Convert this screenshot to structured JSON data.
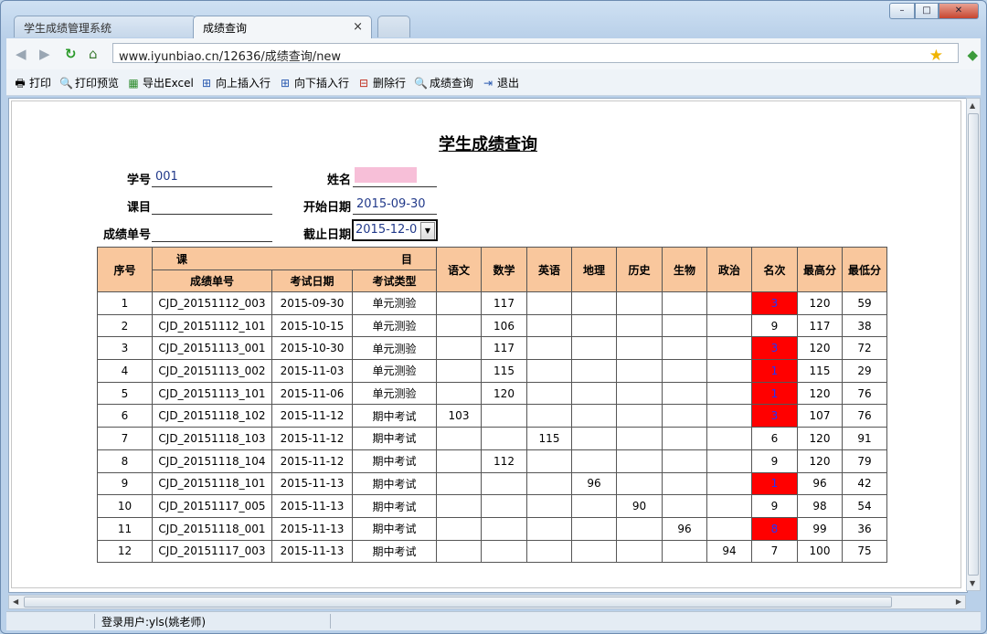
{
  "browser": {
    "tabs": [
      {
        "label": "学生成绩管理系统",
        "active": false
      },
      {
        "label": "成绩查询",
        "active": true
      }
    ],
    "tab_close": "×",
    "url": "www.iyunbiao.cn/12636/成绩查询/new",
    "window_controls": {
      "minimize": "–",
      "maximize": "□",
      "close": "✕"
    }
  },
  "toolbar": {
    "items": [
      {
        "label": "打印",
        "icon": "printer-icon"
      },
      {
        "label": "打印预览",
        "icon": "print-preview-icon"
      },
      {
        "label": "导出Excel",
        "icon": "excel-icon"
      },
      {
        "label": "向上插入行",
        "icon": "insert-row-above-icon"
      },
      {
        "label": "向下插入行",
        "icon": "insert-row-below-icon"
      },
      {
        "label": "删除行",
        "icon": "delete-row-icon"
      },
      {
        "label": "成绩查询",
        "icon": "query-icon"
      },
      {
        "label": "退出",
        "icon": "exit-icon"
      }
    ]
  },
  "form": {
    "title": "学生成绩查询",
    "student_id_label": "学号",
    "student_id": "001",
    "name_label": "姓名",
    "subject_label": "课目",
    "subject": "",
    "start_date_label": "开始日期",
    "start_date": "2015-09-30",
    "record_no_label": "成绩单号",
    "record_no": "",
    "end_date_label": "截止日期",
    "end_date": "2015-12-0"
  },
  "table": {
    "header": {
      "seq": "序号",
      "ke": "课",
      "mu": "目",
      "record_no": "成绩单号",
      "exam_date": "考试日期",
      "exam_type": "考试类型",
      "subjects": [
        "语文",
        "数学",
        "英语",
        "地理",
        "历史",
        "生物",
        "政治"
      ],
      "rank": "名次",
      "max": "最高分",
      "min": "最低分"
    },
    "rows": [
      {
        "seq": "1",
        "no": "CJD_20151112_003",
        "date": "2015-09-30",
        "type": "单元测验",
        "scores": [
          "",
          "117",
          "",
          "",
          "",
          "",
          ""
        ],
        "rank": "3",
        "rank_highlight": true,
        "max": "120",
        "min": "59"
      },
      {
        "seq": "2",
        "no": "CJD_20151112_101",
        "date": "2015-10-15",
        "type": "单元测验",
        "scores": [
          "",
          "106",
          "",
          "",
          "",
          "",
          ""
        ],
        "rank": "9",
        "rank_highlight": false,
        "max": "117",
        "min": "38"
      },
      {
        "seq": "3",
        "no": "CJD_20151113_001",
        "date": "2015-10-30",
        "type": "单元测验",
        "scores": [
          "",
          "117",
          "",
          "",
          "",
          "",
          ""
        ],
        "rank": "3",
        "rank_highlight": true,
        "max": "120",
        "min": "72"
      },
      {
        "seq": "4",
        "no": "CJD_20151113_002",
        "date": "2015-11-03",
        "type": "单元测验",
        "scores": [
          "",
          "115",
          "",
          "",
          "",
          "",
          ""
        ],
        "rank": "1",
        "rank_highlight": true,
        "max": "115",
        "min": "29"
      },
      {
        "seq": "5",
        "no": "CJD_20151113_101",
        "date": "2015-11-06",
        "type": "单元测验",
        "scores": [
          "",
          "120",
          "",
          "",
          "",
          "",
          ""
        ],
        "rank": "1",
        "rank_highlight": true,
        "max": "120",
        "min": "76"
      },
      {
        "seq": "6",
        "no": "CJD_20151118_102",
        "date": "2015-11-12",
        "type": "期中考试",
        "scores": [
          "103",
          "",
          "",
          "",
          "",
          "",
          ""
        ],
        "rank": "3",
        "rank_highlight": true,
        "max": "107",
        "min": "76"
      },
      {
        "seq": "7",
        "no": "CJD_20151118_103",
        "date": "2015-11-12",
        "type": "期中考试",
        "scores": [
          "",
          "",
          "115",
          "",
          "",
          "",
          ""
        ],
        "rank": "6",
        "rank_highlight": false,
        "max": "120",
        "min": "91"
      },
      {
        "seq": "8",
        "no": "CJD_20151118_104",
        "date": "2015-11-12",
        "type": "期中考试",
        "scores": [
          "",
          "112",
          "",
          "",
          "",
          "",
          ""
        ],
        "rank": "9",
        "rank_highlight": false,
        "max": "120",
        "min": "79"
      },
      {
        "seq": "9",
        "no": "CJD_20151118_101",
        "date": "2015-11-13",
        "type": "期中考试",
        "scores": [
          "",
          "",
          "",
          "96",
          "",
          "",
          ""
        ],
        "rank": "1",
        "rank_highlight": true,
        "max": "96",
        "min": "42"
      },
      {
        "seq": "10",
        "no": "CJD_20151117_005",
        "date": "2015-11-13",
        "type": "期中考试",
        "scores": [
          "",
          "",
          "",
          "",
          "90",
          "",
          ""
        ],
        "rank": "9",
        "rank_highlight": false,
        "max": "98",
        "min": "54"
      },
      {
        "seq": "11",
        "no": "CJD_20151118_001",
        "date": "2015-11-13",
        "type": "期中考试",
        "scores": [
          "",
          "",
          "",
          "",
          "",
          "96",
          ""
        ],
        "rank": "8",
        "rank_highlight": true,
        "max": "99",
        "min": "36"
      },
      {
        "seq": "12",
        "no": "CJD_20151117_003",
        "date": "2015-11-13",
        "type": "期中考试",
        "scores": [
          "",
          "",
          "",
          "",
          "",
          "",
          "94"
        ],
        "rank": "7",
        "rank_highlight": false,
        "max": "100",
        "min": "75"
      }
    ]
  },
  "status": {
    "user": "登录用户:yls(姚老师)"
  },
  "colors": {
    "header_bg": "#f9c79d",
    "rank_highlight": "#ff0000",
    "rank_text": "#2233ff",
    "name_field": "#f7bfd8"
  }
}
